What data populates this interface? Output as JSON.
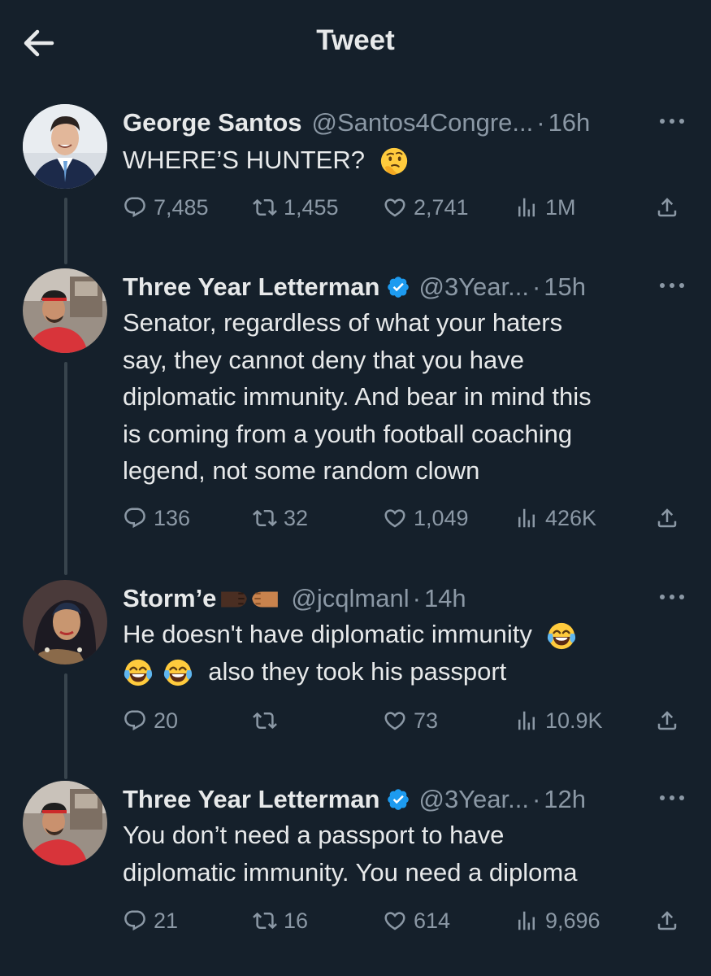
{
  "header": {
    "title": "Tweet",
    "back_icon": "arrow-left-icon"
  },
  "colors": {
    "background": "#15202b",
    "text": "#e7e9ea",
    "muted": "#8b98a5",
    "verified": "#1d9bf0"
  },
  "tweets": [
    {
      "name": "George Santos",
      "name_emoji": "",
      "verified": false,
      "handle": "@Santos4Congre...",
      "time": "16h",
      "text": "WHERE’S HUNTER?",
      "text_emoji": "thinking-face",
      "line2": "",
      "replies": "7,485",
      "retweets": "1,455",
      "likes": "2,741",
      "views": "1M"
    },
    {
      "name": "Three Year Letterman",
      "verified": true,
      "handle": "@3Year...",
      "time": "15h",
      "lines": [
        "Senator, regardless of what your haters",
        "say, they cannot deny that you have",
        "diplomatic immunity. And bear in mind this",
        "is coming from a youth football coaching",
        "legend, not some random clown"
      ],
      "replies": "136",
      "retweets": "32",
      "likes": "1,049",
      "views": "426K"
    },
    {
      "name": "Storm’e",
      "name_emoji": "fist-bump",
      "verified": false,
      "handle": "@jcqlmanl",
      "time": "14h",
      "line1": "He doesn't have diplomatic immunity",
      "line2": "also they took his passport",
      "text_emoji": "face-with-tears-of-joy",
      "replies": "20",
      "retweets": "",
      "likes": "73",
      "views": "10.9K"
    },
    {
      "name": "Three Year Letterman",
      "verified": true,
      "handle": "@3Year...",
      "time": "12h",
      "lines": [
        "You don’t need a passport to have",
        "diplomatic immunity. You need a diploma"
      ],
      "replies": "21",
      "retweets": "16",
      "likes": "614",
      "views": "9,696"
    }
  ]
}
